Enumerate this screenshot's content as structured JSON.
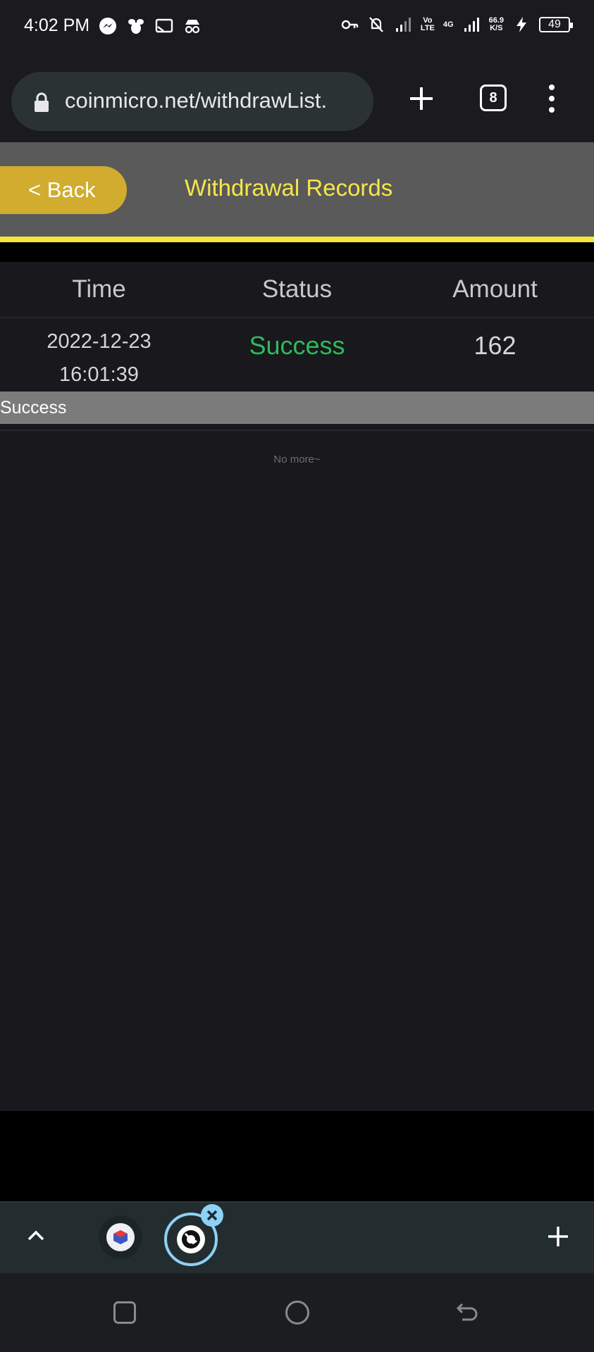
{
  "status_bar": {
    "time": "4:02 PM",
    "left_icons": [
      "messenger-icon",
      "bee-icon",
      "screencast-icon",
      "incognito-icon"
    ],
    "network_label_top": "Vo",
    "network_label_bottom": "LTE",
    "network_gen": "4G",
    "speed_value": "66.9",
    "speed_unit": "K/S",
    "battery": "49"
  },
  "browser": {
    "url": "coinmicro.net/withdrawList.",
    "tab_count": "8"
  },
  "header": {
    "back_label": "< Back",
    "title": "Withdrawal Records",
    "accent_color": "#f7e64a",
    "back_color": "#d2ac2e"
  },
  "table": {
    "columns": [
      "Time",
      "Status",
      "Amount"
    ],
    "rows": [
      {
        "date": "2022-12-23",
        "time": "16:01:39",
        "status": "Success",
        "amount": "162",
        "note": "Success"
      }
    ],
    "status_color": "#2ebb5b",
    "footer_text": "No more~"
  }
}
